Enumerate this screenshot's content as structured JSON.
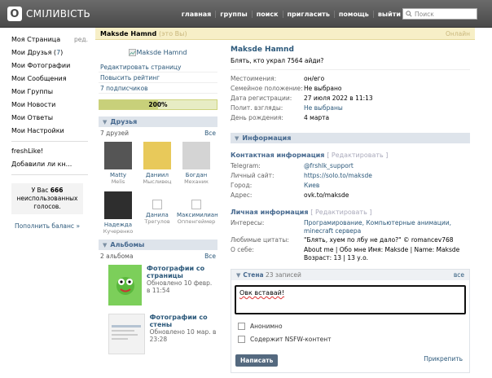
{
  "app": {
    "logo_letter": "О",
    "name": "СМІЛИВІСТЬ"
  },
  "nav": [
    "главная",
    "группы",
    "поиск",
    "пригласить",
    "помощь",
    "выйти"
  ],
  "search": {
    "placeholder": "Поиск"
  },
  "menu": {
    "items": [
      {
        "label": "Моя Страница",
        "extra": "ред."
      },
      {
        "label": "Мои Друзья",
        "count": "7"
      },
      {
        "label": "Мои Фотографии"
      },
      {
        "label": "Мои Сообщения"
      },
      {
        "label": "Мои Группы"
      },
      {
        "label": "Мои Новости"
      },
      {
        "label": "Мои Ответы"
      },
      {
        "label": "Мои Настройки"
      }
    ],
    "apps": [
      "freshLike!",
      "Добавили ли кн..."
    ],
    "unused_prefix": "У Вас ",
    "unused_count": "666",
    "unused_suffix": " неиспользованных голосов.",
    "topup": "Пополнить баланс »"
  },
  "profile": {
    "name": "Maksde Hamnd",
    "me_tag": "(это Вы)",
    "online": "Онлайн",
    "avatar_alt": "Maksde Hamnd",
    "status": "Блять, кто украл 7564 айди?",
    "edit_page": "Редактировать страницу",
    "raise_rating": "Повысить рейтинг",
    "subscribers": "7 подписчиков",
    "rating": "200%",
    "rating_value": 0.5
  },
  "basic_info": [
    {
      "k": "Местоимения:",
      "v": "он/его",
      "link": false
    },
    {
      "k": "Семейное положение:",
      "v": "Не выбрано",
      "link": false
    },
    {
      "k": "Дата регистрации:",
      "v": "27 июля 2022 в 11:13",
      "link": false
    },
    {
      "k": "Полит. взгляды:",
      "v": "Не выбраны",
      "link": true
    },
    {
      "k": "День рождения:",
      "v": "4 марта",
      "link": false
    }
  ],
  "friends_section": {
    "title": "Друзья",
    "count": "7 друзей",
    "all": "Все"
  },
  "friends": [
    {
      "name": "Matty",
      "sub": "Melis",
      "color": "#6a6a6a"
    },
    {
      "name": "Даниил",
      "sub": "Мысливец",
      "color": "#e8c95a"
    },
    {
      "name": "Богдан",
      "sub": "Механик",
      "color": "#cfcfcf"
    },
    {
      "name": "Надежда",
      "sub": "Кучеренко",
      "color": "#3a3a3a"
    },
    {
      "name": "Данила",
      "sub": "Трегулов",
      "color": "#fff"
    },
    {
      "name": "Максимилиан",
      "sub": "Оппенгеймер",
      "color": "#fff"
    }
  ],
  "albums_section": {
    "title": "Альбомы",
    "count": "2 альбома",
    "all": "Все"
  },
  "albums": [
    {
      "title": "Фотографии со страницы",
      "updated": "Обновлено 10 февр. в 11:54"
    },
    {
      "title": "Фотографии со стены",
      "updated": "Обновлено 10 мар. в 23:28"
    }
  ],
  "info_section": {
    "title": "Информация"
  },
  "contact": {
    "title": "Контактная информация",
    "edit": "[ Редактировать ]",
    "rows": [
      {
        "k": "Telegram:",
        "v": "@frshlk_support",
        "link": true
      },
      {
        "k": "Личный сайт:",
        "v": "https://solo.to/maksde",
        "link": true
      },
      {
        "k": "Город:",
        "v": "Киев",
        "link": true
      },
      {
        "k": "Адрес:",
        "v": "ovk.to/maksde",
        "link": false
      }
    ]
  },
  "personal": {
    "title": "Личная информация",
    "edit": "[ Редактировать ]",
    "rows": [
      {
        "k": "Интересы:",
        "v": "Програмирование, Компьютерные анимации, minecraft сервера",
        "link": true
      },
      {
        "k": "Любимые цитаты:",
        "v": "\"Блять, хуем по лбу не дало?\" © romancev768",
        "link": false
      },
      {
        "k": "О себе:",
        "v": "About me | Обо мне Имя: Maksde | Name: Maksde Возраст: 13 | 13 у.о.",
        "link": false
      }
    ]
  },
  "wall": {
    "title": "Стена",
    "count": "23 записей",
    "all": "все",
    "text": "Овк вставай!",
    "anon": "Анонимно",
    "nsfw": "Содержит NSFW-контент",
    "post": "Написать",
    "attach": "Прикрепить"
  },
  "colors": {
    "topbar": "#555555",
    "link": "#2b587a",
    "section": "#dee4eb",
    "profbar": "#f7efc7"
  }
}
